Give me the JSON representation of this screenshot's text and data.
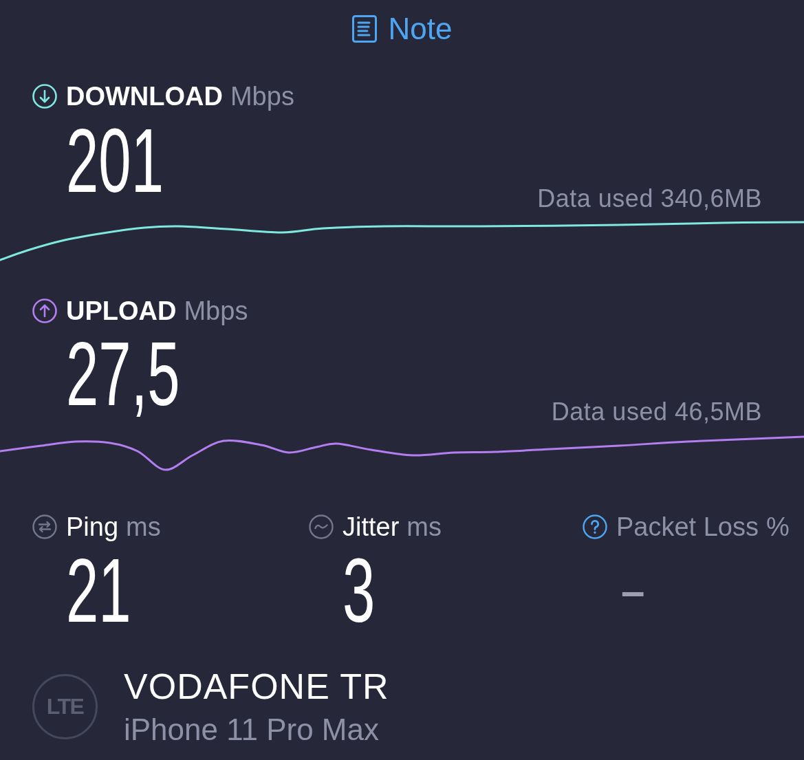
{
  "note_button": {
    "label": "Note"
  },
  "speeds": [
    {
      "kind": "download",
      "label": "DOWNLOAD",
      "unit": "Mbps",
      "value": "201",
      "data_used": "Data used 340,6MB",
      "color": "#7fe9e1"
    },
    {
      "kind": "upload",
      "label": "UPLOAD",
      "unit": "Mbps",
      "value": "27,5",
      "data_used": "Data used 46,5MB",
      "color": "#b27ef0"
    }
  ],
  "metrics": [
    {
      "kind": "ping",
      "label": "Ping",
      "unit": "ms",
      "value": "21",
      "disabled": false
    },
    {
      "kind": "jitter",
      "label": "Jitter",
      "unit": "ms",
      "value": "3",
      "disabled": false
    },
    {
      "kind": "packet_loss",
      "label": "Packet Loss",
      "unit": "%",
      "value": "–",
      "disabled": true
    }
  ],
  "connection": {
    "network_type": "LTE",
    "carrier": "VODAFONE TR",
    "device": "iPhone 11 Pro Max"
  }
}
